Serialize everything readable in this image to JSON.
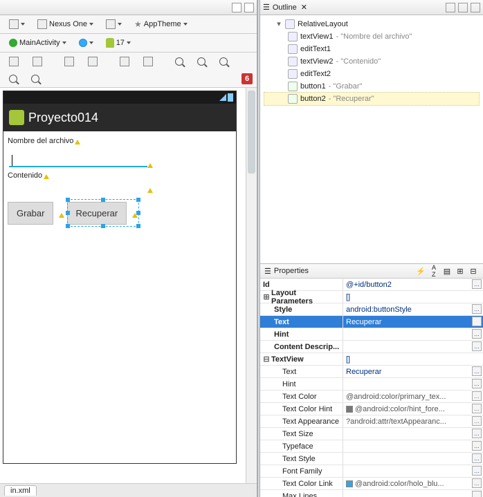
{
  "toolbar1": {
    "device": "Nexus One",
    "theme": "AppTheme"
  },
  "toolbar2": {
    "activity": "MainActivity",
    "api": "17"
  },
  "redcount": "6",
  "app": {
    "title": "Proyecto014",
    "label1": "Nombre del archivo",
    "label2": "Contenido",
    "btn1": "Grabar",
    "btn2": "Recuperar"
  },
  "footer_tab": "in.xml",
  "outline": {
    "title": "Outline",
    "root": "RelativeLayout",
    "items": [
      {
        "id": "textView1",
        "desc": "Nombre del archivo"
      },
      {
        "id": "editText1",
        "desc": ""
      },
      {
        "id": "textView2",
        "desc": "Contenido"
      },
      {
        "id": "editText2",
        "desc": ""
      },
      {
        "id": "button1",
        "desc": "Grabar"
      },
      {
        "id": "button2",
        "desc": "Recuperar",
        "selected": true
      }
    ]
  },
  "props": {
    "title": "Properties",
    "rows": {
      "id_label": "Id",
      "id_val": "@+id/button2",
      "layout_label": "Layout Parameters",
      "layout_val": "[]",
      "style_label": "Style",
      "style_val": "android:buttonStyle",
      "text_label": "Text",
      "text_val": "Recuperar",
      "hint_label": "Hint",
      "hint_val": "",
      "cd_label": "Content Descrip...",
      "cd_val": "",
      "tv_label": "TextView",
      "tv_val": "[]",
      "tv_text_label": "Text",
      "tv_text_val": "Recuperar",
      "tv_hint_label": "Hint",
      "tv_hint_val": "",
      "tc_label": "Text Color",
      "tc_val": "@android:color/primary_tex...",
      "tch_label": "Text Color Hint",
      "tch_val": "@android:color/hint_fore...",
      "ta_label": "Text Appearance",
      "ta_val": "?android:attr/textAppearanc...",
      "ts_label": "Text Size",
      "tf_label": "Typeface",
      "tst_label": "Text Style",
      "ff_label": "Font Family",
      "tcl_label": "Text Color Link",
      "tcl_val": "@android:color/holo_blu...",
      "ml_label": "Max Lines"
    }
  }
}
